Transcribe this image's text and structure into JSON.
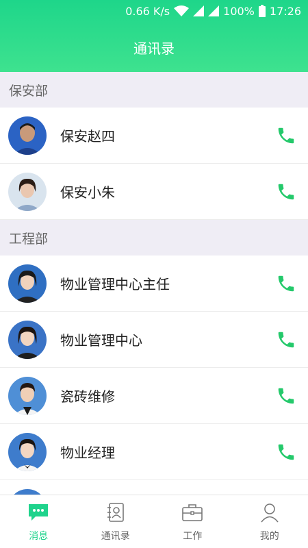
{
  "status_bar": {
    "speed": "0.66 K/s",
    "battery": "100%",
    "time": "17:26"
  },
  "header": {
    "title": "通讯录"
  },
  "sections": [
    {
      "label": "保安部",
      "contacts": [
        {
          "name": "保安赵四"
        },
        {
          "name": "保安小朱"
        }
      ]
    },
    {
      "label": "工程部",
      "contacts": [
        {
          "name": "物业管理中心主任"
        },
        {
          "name": "物业管理中心"
        },
        {
          "name": "瓷砖维修"
        },
        {
          "name": "物业经理"
        }
      ]
    }
  ],
  "tabbar": {
    "items": [
      {
        "label": "消息",
        "icon": "message-icon",
        "active": true
      },
      {
        "label": "通讯录",
        "icon": "contacts-icon",
        "active": false
      },
      {
        "label": "工作",
        "icon": "briefcase-icon",
        "active": false
      },
      {
        "label": "我的",
        "icon": "person-icon",
        "active": false
      }
    ]
  },
  "colors": {
    "accent": "#1fd38c",
    "phone": "#24c96b",
    "section_bg": "#efedf5"
  }
}
